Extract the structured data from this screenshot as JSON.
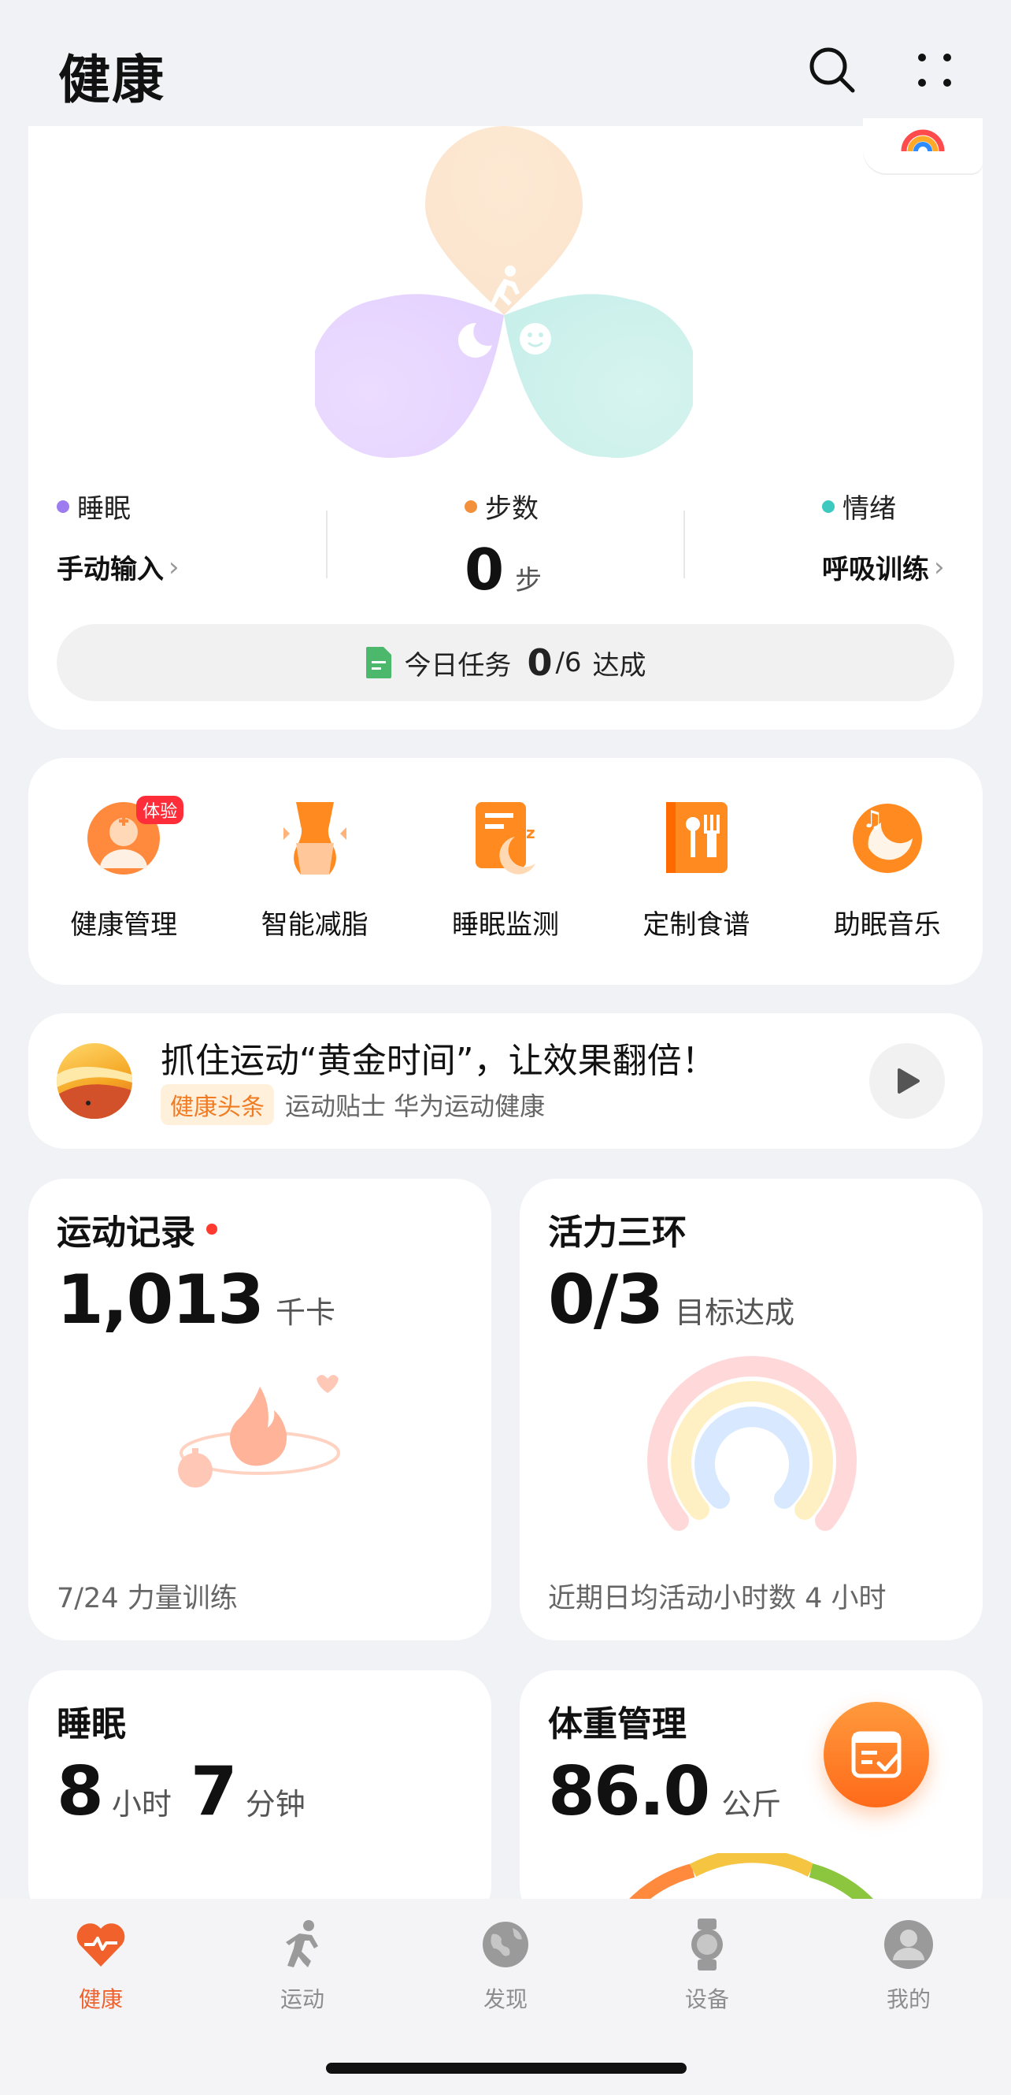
{
  "header": {
    "title": "健康"
  },
  "hero": {
    "metrics": [
      {
        "label": "睡眠",
        "value": "手动输入",
        "color": "#9d7cf0"
      },
      {
        "label": "步数",
        "value": "0",
        "unit": "步",
        "color": "#f3903b"
      },
      {
        "label": "情绪",
        "value": "呼吸训练",
        "color": "#3dc8c0"
      }
    ],
    "task": {
      "prefix": "今日任务",
      "done": "0",
      "total": "/6",
      "suffix": "达成"
    }
  },
  "quick_entries": [
    {
      "label": "健康管理",
      "badge": "体验",
      "icon": "doctor-icon"
    },
    {
      "label": "智能减脂",
      "icon": "waist-icon"
    },
    {
      "label": "睡眠监测",
      "icon": "sleep-report-icon"
    },
    {
      "label": "定制食谱",
      "icon": "recipe-icon"
    },
    {
      "label": "助眠音乐",
      "icon": "sleep-music-icon"
    }
  ],
  "article": {
    "title": "抓住运动“黄金时间”，让效果翻倍！",
    "tag": "健康头条",
    "source": "运动贴士 华为运动健康"
  },
  "tiles": {
    "exercise": {
      "title": "运动记录",
      "value": "1,013",
      "unit": "千卡",
      "footer": "7/24 力量训练"
    },
    "rings": {
      "title": "活力三环",
      "value": "0/3",
      "unit": "目标达成",
      "footer": "近期日均活动小时数 4 小时"
    },
    "sleep": {
      "title": "睡眠",
      "hours": "8",
      "hours_unit": "小时",
      "minutes": "7",
      "minutes_unit": "分钟"
    },
    "weight": {
      "title": "体重管理",
      "value": "86.0",
      "unit": "公斤"
    }
  },
  "tabbar": {
    "items": [
      {
        "label": "健康",
        "icon": "heart-pulse-icon",
        "active": true
      },
      {
        "label": "运动",
        "icon": "runner-icon"
      },
      {
        "label": "发现",
        "icon": "globe-icon"
      },
      {
        "label": "设备",
        "icon": "watch-icon"
      },
      {
        "label": "我的",
        "icon": "person-icon"
      }
    ]
  },
  "colors": {
    "accent": "#f0612c",
    "background": "#f1f2f5"
  }
}
